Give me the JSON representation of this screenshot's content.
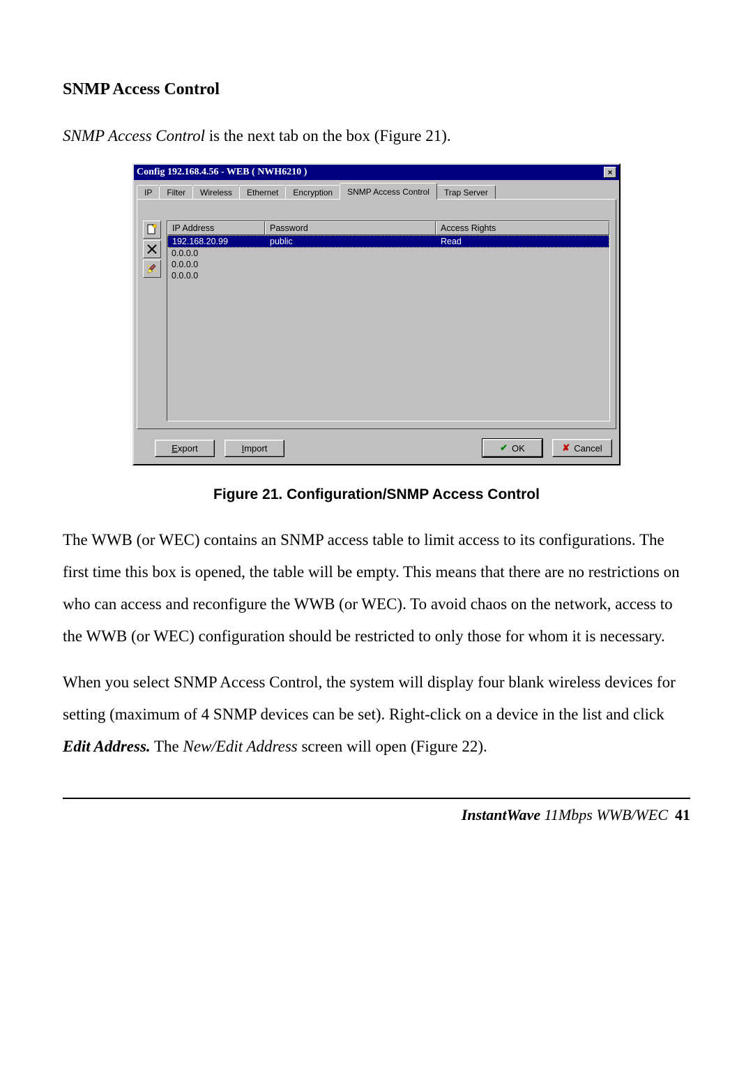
{
  "heading": "SNMP Access Control",
  "intro_italic": "SNMP Access Control",
  "intro_rest": " is the next tab on the box (Figure 21).",
  "dialog": {
    "title": "Config 192.168.4.56 - WEB ( NWH6210 )",
    "close_glyph": "×",
    "tabs": [
      "IP",
      "Filter",
      "Wireless",
      "Ethernet",
      "Encryption",
      "SNMP Access Control",
      "Trap Server"
    ],
    "active_tab_index": 5,
    "columns": [
      "IP Address",
      "Password",
      "Access Rights"
    ],
    "rows": [
      {
        "ip": "192.168.20.99",
        "password": "public",
        "rights": "Read",
        "selected": true
      },
      {
        "ip": "0.0.0.0",
        "password": "",
        "rights": "",
        "selected": false
      },
      {
        "ip": "0.0.0.0",
        "password": "",
        "rights": "",
        "selected": false
      },
      {
        "ip": "0.0.0.0",
        "password": "",
        "rights": "",
        "selected": false
      }
    ],
    "buttons": {
      "export": "Export",
      "import": "Import",
      "ok": "OK",
      "cancel": "Cancel"
    }
  },
  "figure_caption": "Figure 21.    Configuration/SNMP Access Control",
  "para1": "The WWB (or WEC) contains an SNMP access table to limit access to its configurations. The first time this box is opened, the table will be empty. This means that there are no restrictions on who can access and reconfigure the WWB (or WEC). To avoid chaos on the network, access to the WWB (or WEC) configuration should be restricted to only those for whom it is necessary.",
  "para2_a": "When you select SNMP Access Control, the system will display four blank wireless devices for setting (maximum of 4 SNMP devices can be set). Right-click on a device in the list and click ",
  "para2_bi": "Edit Address.",
  "para2_b": " The ",
  "para2_i": "New/Edit Address",
  "para2_c": " screen will open (Figure 22).",
  "footer": {
    "product": "InstantWave",
    "model": " 11Mbps WWB/WEC",
    "page": "41"
  }
}
